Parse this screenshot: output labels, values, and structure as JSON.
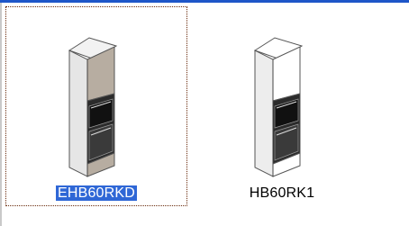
{
  "items": [
    {
      "label": "EHB60RKD",
      "selected": true
    },
    {
      "label": "HB60RK1",
      "selected": false
    }
  ],
  "colors": {
    "selection_bg": "#2f67d6",
    "selection_border": "#6b2c0e",
    "cabinet_door": "#b7ada1",
    "cabinet_white": "#ffffff"
  }
}
